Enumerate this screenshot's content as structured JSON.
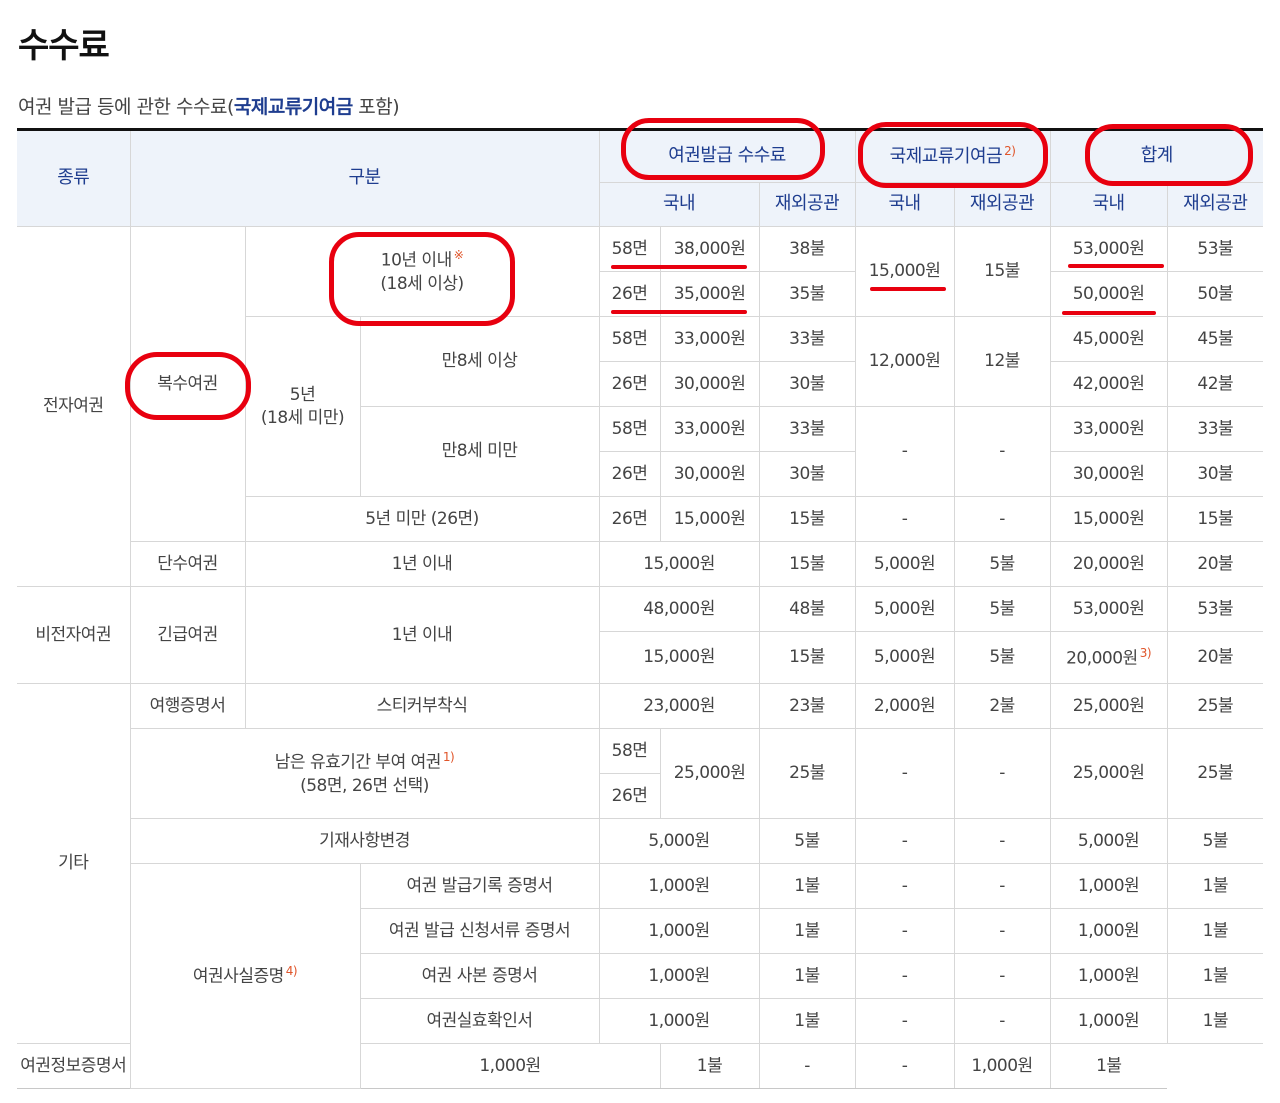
{
  "page": {
    "title": "수수료",
    "subtitle_prefix": "여권 발급 등에 관한 수수료(",
    "subtitle_highlight": "국제교류기여금",
    "subtitle_suffix": " 포함)"
  },
  "header": {
    "kind": "종류",
    "category": "구분",
    "issue_fee": "여권발급 수수료",
    "contribution": "국제교류기여금",
    "contribution_note": "2)",
    "total": "합계",
    "domestic": "국내",
    "overseas": "재외공관"
  },
  "labels": {
    "e_passport": "전자여권",
    "multiple": "복수여권",
    "ten_years": "10년 이내",
    "ten_years_mark": "※",
    "ten_years_age": "(18세 이상)",
    "five_years": "5년",
    "five_years_age": "(18세 미만)",
    "over8": "만8세 이상",
    "under8": "만8세 미만",
    "under5": "5년 미만 (26면)",
    "single": "단수여권",
    "within1": "1년 이내",
    "non_e_passport": "비전자여권",
    "emergency": "긴급여권",
    "etc": "기타",
    "travel_cert": "여행증명서",
    "sticker": "스티커부착식",
    "remaining": "남은 유효기간 부여 여권",
    "remaining_note": "1)",
    "remaining_sub": "(58면, 26면 선택)",
    "modify": "기재사항변경",
    "fact_cert": "여권사실증명",
    "fact_cert_note": "4)",
    "cert1": "여권 발급기록 증명서",
    "cert2": "여권 발급 신청서류 증명서",
    "cert3": "여권 사본 증명서",
    "cert4": "여권실효확인서",
    "cert5": "여권정보증명서",
    "p58": "58면",
    "p26": "26면",
    "dash": "-"
  },
  "fees": {
    "w53000": "53,000원",
    "w50000": "50,000원",
    "w48000": "48,000원",
    "w45000": "45,000원",
    "w42000": "42,000원",
    "w38000": "38,000원",
    "w35000": "35,000원",
    "w33000": "33,000원",
    "w30000": "30,000원",
    "w25000": "25,000원",
    "w23000": "23,000원",
    "w20000": "20,000원",
    "w15000": "15,000원",
    "w12000": "12,000원",
    "w5000": "5,000원",
    "w2000": "2,000원",
    "w1000": "1,000원",
    "d53": "53불",
    "d50": "50불",
    "d48": "48불",
    "d45": "45불",
    "d42": "42불",
    "d38": "38불",
    "d35": "35불",
    "d33": "33불",
    "d30": "30불",
    "d25": "25불",
    "d23": "23불",
    "d20": "20불",
    "d15": "15불",
    "d12": "12불",
    "d5": "5불",
    "d2": "2불",
    "d1": "1불",
    "note3": "3)"
  },
  "colors": {
    "annotation": "#e8000f",
    "header_bg": "#eef3fa",
    "header_text": "#1e3d8f",
    "footnote": "#e0552a"
  }
}
